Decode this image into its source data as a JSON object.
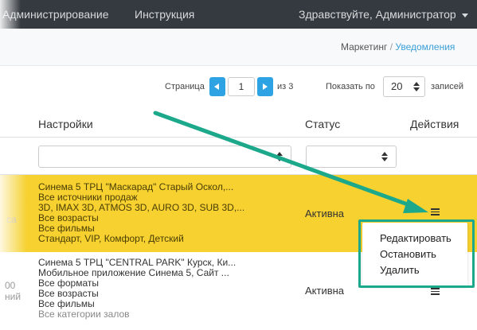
{
  "nav": {
    "admin": "Администрирование",
    "instruction": "Инструкция",
    "greeting": "Здравствуйте, Администратор"
  },
  "breadcrumb": {
    "parent": "Маркетинг",
    "separator": "/",
    "current": "Уведомления"
  },
  "pagination": {
    "page_label": "Страница",
    "page_value": "1",
    "of_label": "из 3",
    "show_label": "Показать по",
    "per_page": "20",
    "records_label": "записей"
  },
  "table": {
    "headers": {
      "settings": "Настройки",
      "status": "Статус",
      "actions": "Действия"
    },
    "rows": [
      {
        "lines": [
          "Синема 5 ТРЦ \"Маскарад\" Старый Оскол,...",
          "Все источники продаж",
          "3D, IMAX 3D, ATMOS 3D, AURO 3D, SUB 3D,...",
          "Все возрасты",
          "Все фильмы",
          "Стандарт, VIP, Комфорт, Детский"
        ],
        "status": "Активна",
        "left_fragment": "са"
      },
      {
        "lines": [
          "Синема 5 ТРЦ \"CENTRAL PARK\" Курск, Ки...",
          "Мобильное приложение Синема 5, Сайт ...",
          "Все форматы",
          "Все возрасты",
          "Все фильмы",
          "Все категории залов"
        ],
        "status": "Активна",
        "left_fragments": [
          "00",
          "ний"
        ]
      }
    ]
  },
  "actions_menu": {
    "items": [
      "Редактировать",
      "Остановить",
      "Удалить"
    ]
  },
  "colors": {
    "navbar": "#343a40",
    "highlight_row": "#f6d12f",
    "accent_blue": "#2ea3e3",
    "annotation_green": "#1ca88a"
  },
  "icons": {
    "row_actions": "list-icon",
    "prev": "chevron-left-icon",
    "next": "chevron-right-icon",
    "select": "sort-arrows-icon",
    "user_menu": "caret-down-icon"
  }
}
